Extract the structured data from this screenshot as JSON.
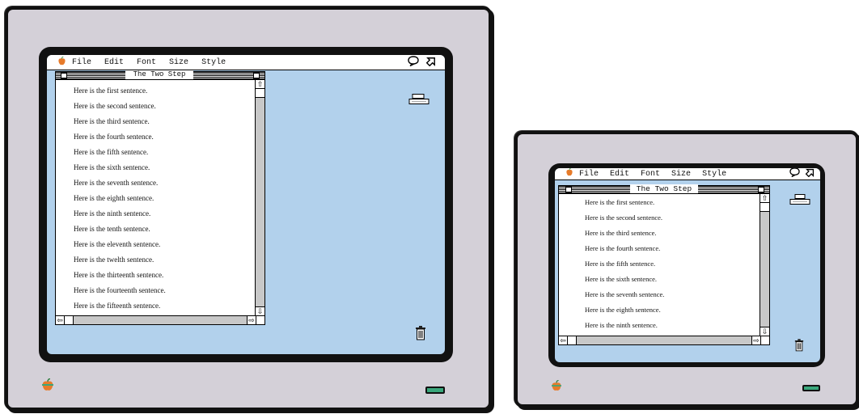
{
  "menubar": {
    "apple": "",
    "items": [
      "File",
      "Edit",
      "Font",
      "Size",
      "Style"
    ],
    "balloon_icon": "balloon-help-icon",
    "app_icon": "application-menu-icon"
  },
  "window": {
    "title": "The Two Step",
    "lines": [
      "Here is the first sentence.",
      "Here is the second sentence.",
      "Here is the third sentence.",
      "Here is the fourth sentence.",
      "Here is the fifth sentence.",
      "Here is the sixth sentence.",
      "Here is the seventh sentence.",
      "Here is the eighth sentence.",
      "Here is the ninth sentence.",
      "Here is the tenth sentence.",
      "Here is the eleventh sentence.",
      "Here is the twelth sentence.",
      "Here is the thirteenth sentence.",
      "Here is the fourteenth sentence.",
      "Here is the fifteenth sentence."
    ]
  },
  "colors": {
    "desktop": "#b2d1ec",
    "monitor_case": "#d4d0d8",
    "apple_logo": "#e77b2a",
    "drive_light": "#3aa77c"
  }
}
